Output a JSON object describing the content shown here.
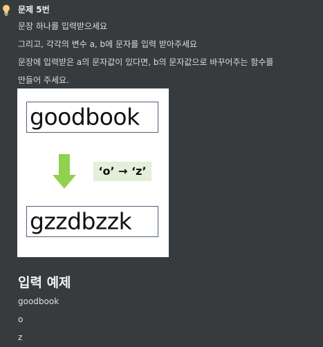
{
  "callout": {
    "icon": "lightbulb-icon",
    "title": "문제 5번"
  },
  "description": [
    "문장 하나를 입력받으세요",
    "그리고, 각각의 변수 a, b에 문자를 입력 받아주세요",
    "문장에 입력받은 a의 문자값이 있다면, b의 문자값으로 바꾸어주는 함수를",
    "만들어 주세요."
  ],
  "figure": {
    "input_word": "goodbook",
    "rule": "‘o’ → ‘z’",
    "output_word": "gzzdbzzk",
    "arrow_color": "#92d050",
    "box_border_color": "#4d6079",
    "rule_background": "#e2efd9"
  },
  "example": {
    "heading": "입력 예제",
    "lines": [
      "goodbook",
      "o",
      "z"
    ]
  },
  "colors": {
    "background": "#373b3e",
    "text": "#e6e6e6"
  }
}
